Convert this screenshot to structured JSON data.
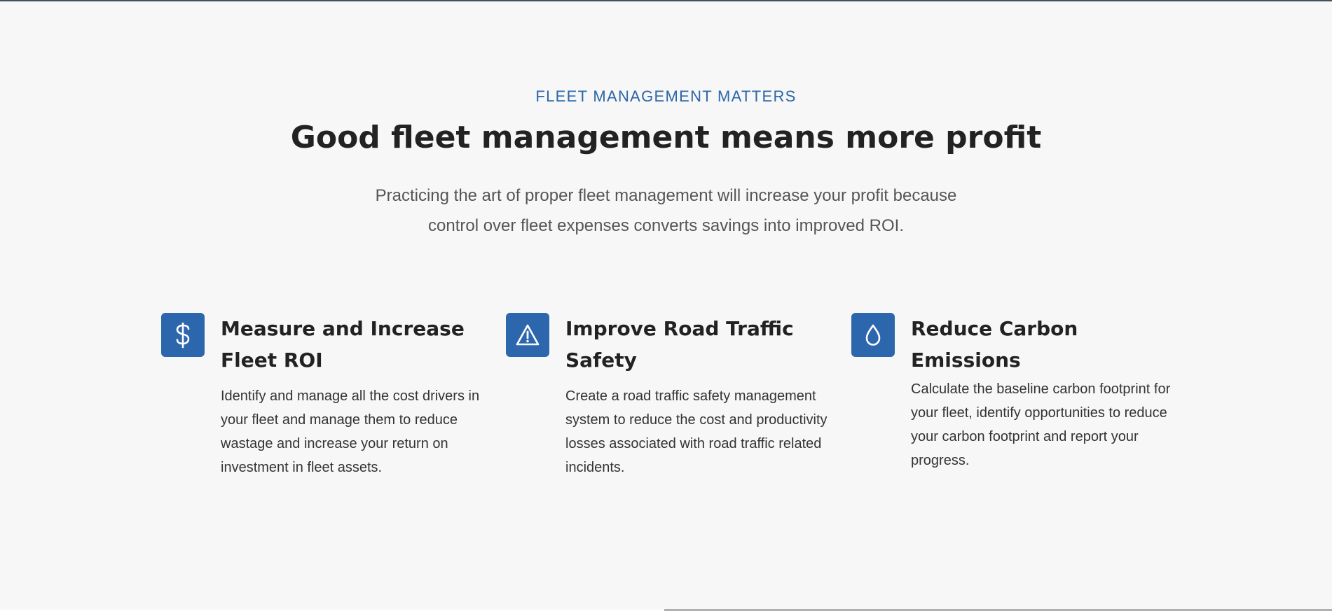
{
  "section": {
    "eyebrow": "FLEET MANAGEMENT MATTERS",
    "title": "Good fleet management means more profit",
    "intro": "Practicing the art of proper fleet management will increase your profit because control over fleet expenses converts savings into improved ROI."
  },
  "features": [
    {
      "icon": "dollar-icon",
      "title": "Measure and Increase Fleet ROI",
      "text": "Identify and manage all the cost drivers in your fleet and manage them to reduce wastage and increase your return on investment in fleet assets."
    },
    {
      "icon": "warning-triangle-icon",
      "title": "Improve Road Traffic Safety",
      "text": "Create a road traffic safety management system to reduce the cost and productivity losses associated with road traffic related incidents."
    },
    {
      "icon": "droplet-icon",
      "title": "Reduce Carbon Emissions",
      "text": "Calculate the baseline carbon footprint for your fleet, identify opportunities to reduce your carbon footprint and report your progress."
    }
  ],
  "colors": {
    "accent": "#2c67ad",
    "eyebrow": "#2c67a8",
    "background": "#f7f7f7",
    "heading": "#222222",
    "intro_text": "#555555"
  }
}
